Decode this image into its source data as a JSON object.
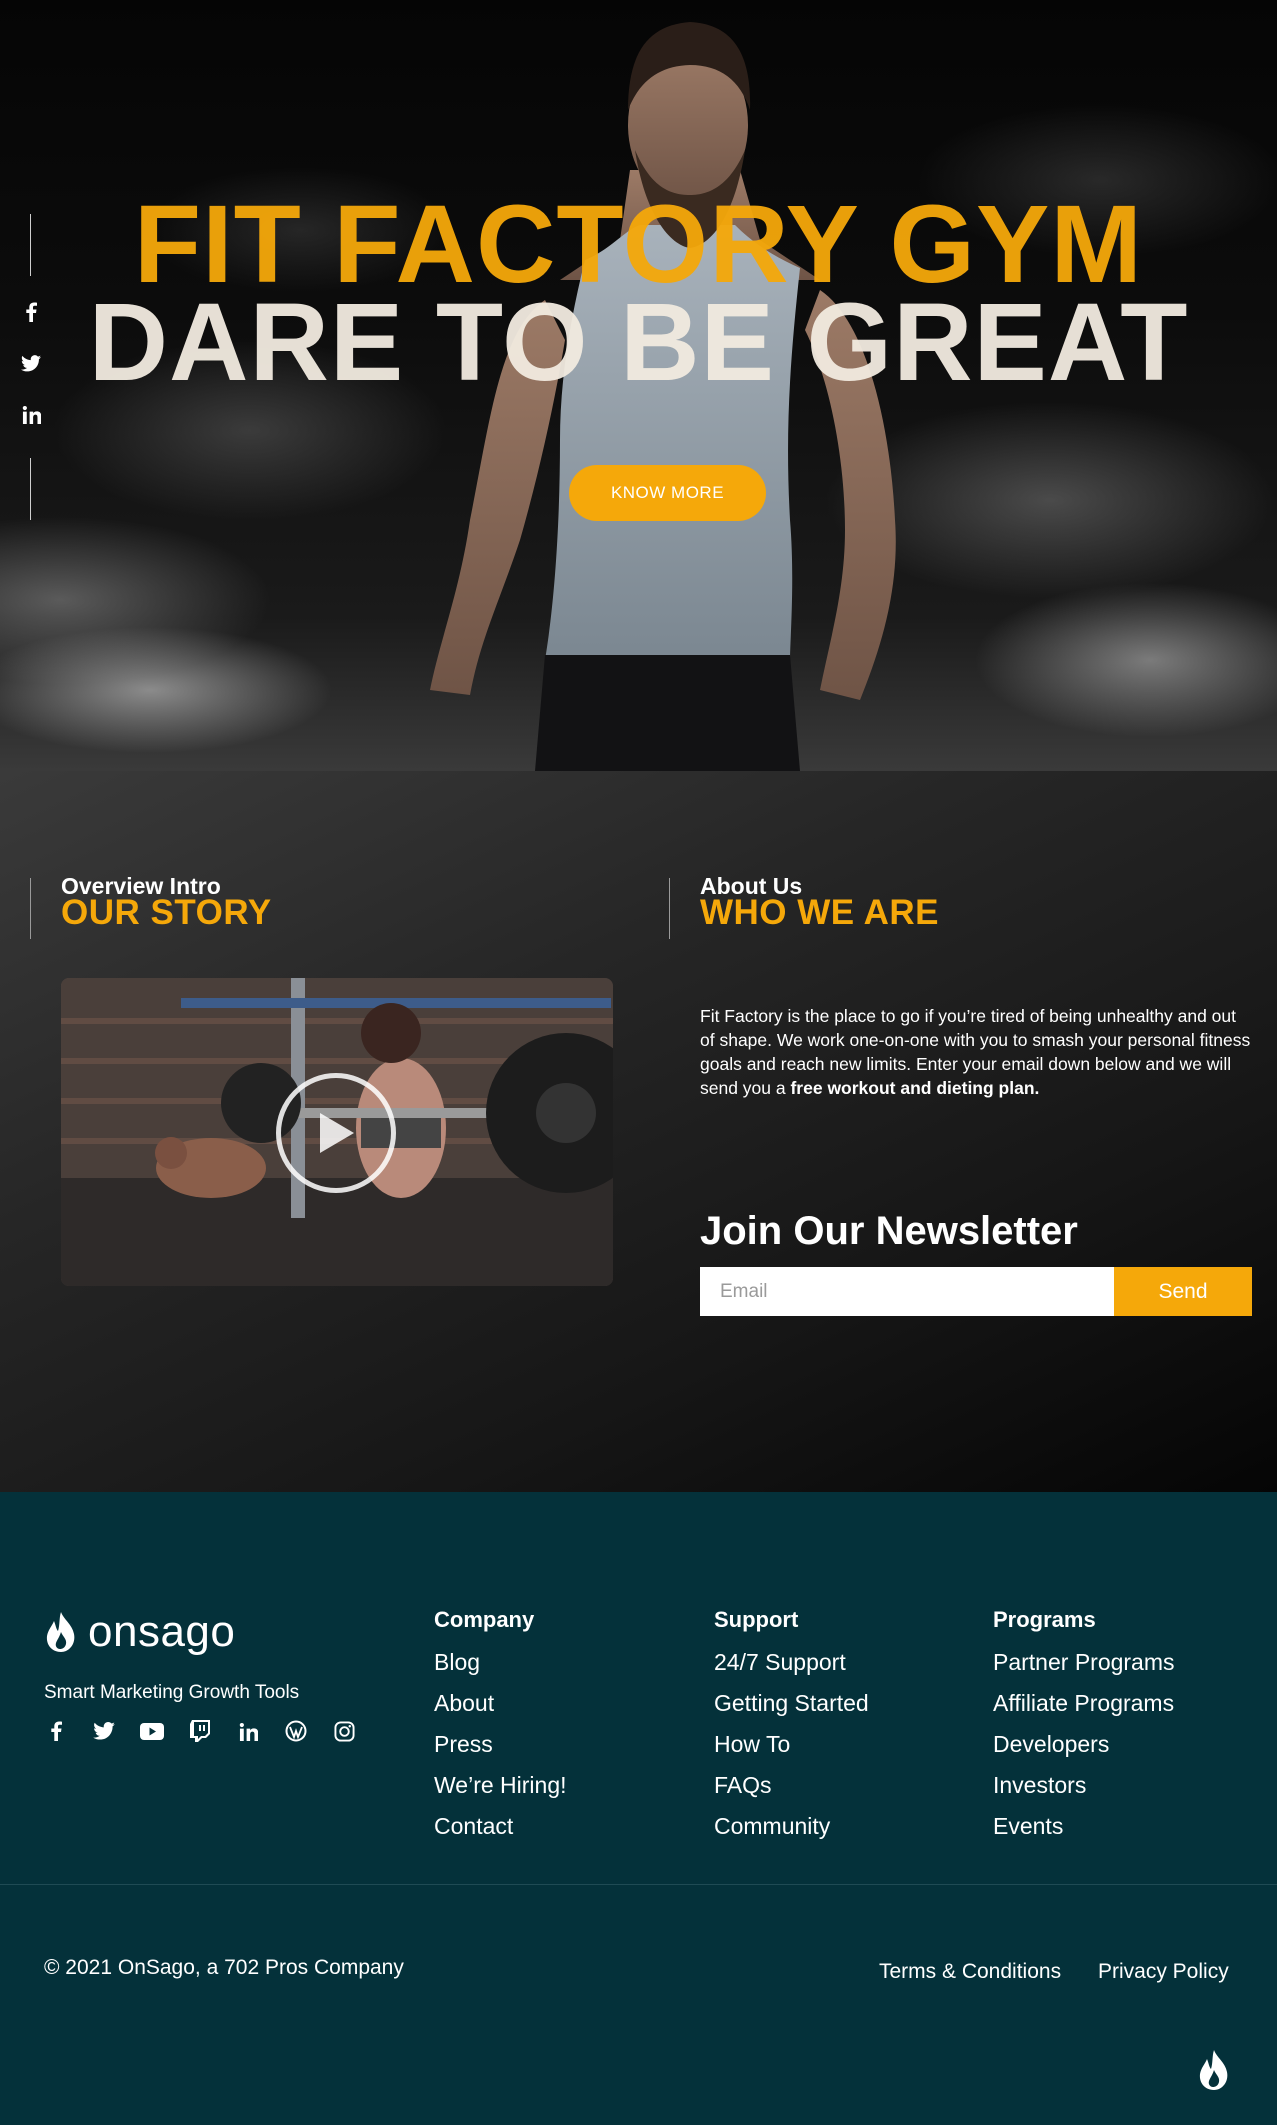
{
  "hero": {
    "title_line1": "FIT FACTORY GYM",
    "title_line2": "DARE TO BE GREAT",
    "cta_label": "KNOW MORE",
    "social_icons": [
      "facebook-icon",
      "twitter-icon",
      "linkedin-icon"
    ]
  },
  "story": {
    "left": {
      "kicker": "Overview Intro",
      "title": "OUR STORY"
    },
    "right": {
      "kicker": "About Us",
      "title": "WHO WE ARE",
      "body_plain": "Fit Factory is the place to go if you’re tired of being unhealthy and out of shape. We work one-on-one with you to smash your personal fitness goals and reach new limits. Enter your email down below and we will send you a ",
      "body_bold": "free workout and dieting plan."
    },
    "video": {
      "icon": "play-icon"
    },
    "newsletter": {
      "title": "Join Our Newsletter",
      "email_placeholder": "Email",
      "send_label": "Send"
    }
  },
  "footer": {
    "brand": "onsago",
    "tagline": "Smart Marketing Growth Tools",
    "social_icons": [
      "facebook-icon",
      "twitter-icon",
      "youtube-icon",
      "twitch-icon",
      "linkedin-icon",
      "wordpress-icon",
      "instagram-icon"
    ],
    "columns": [
      {
        "heading": "Company",
        "links": [
          "Blog",
          "About",
          "Press",
          "We’re Hiring!",
          "Contact"
        ]
      },
      {
        "heading": "Support",
        "links": [
          "24/7 Support",
          "Getting Started",
          "How To",
          "FAQs",
          "Community"
        ]
      },
      {
        "heading": "Programs",
        "links": [
          "Partner Programs",
          "Affiliate Programs",
          "Developers",
          "Investors",
          "Events"
        ]
      }
    ],
    "copyright": "© 2021 OnSago, a 702 Pros Company",
    "legal": {
      "terms": "Terms & Conditions",
      "privacy": "Privacy Policy"
    }
  },
  "colors": {
    "accent": "#f5a80a",
    "footer_bg": "#04313a",
    "cream": "#f2ebe0"
  }
}
